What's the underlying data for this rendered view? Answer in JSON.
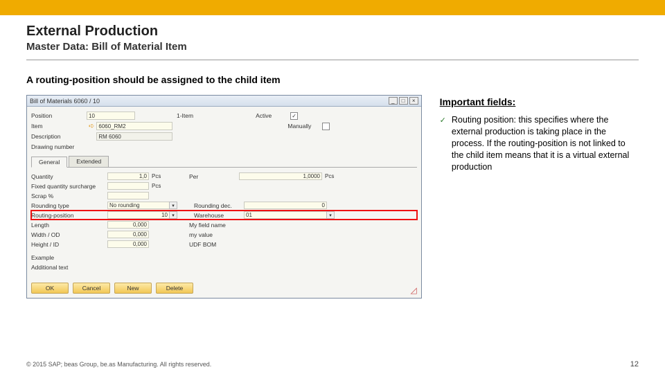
{
  "header": {
    "title": "External Production",
    "subtitle": "Master Data: Bill of Material Item"
  },
  "instruction": "A routing-position should be assigned to the child item",
  "window": {
    "title": "Bill of Materials 6060 / 10",
    "controls": {
      "min": "_",
      "max": "□",
      "close": "×"
    },
    "top_fields": {
      "position_label": "Position",
      "position_value": "10",
      "item_label": "Item",
      "item_value": "6060_RM2",
      "item_id_label": "1-Item",
      "description_label": "Description",
      "description_value": "RM 6060",
      "drawing_label": "Drawing number",
      "active_label": "Active",
      "active_checked": "✓",
      "manually_label": "Manually"
    },
    "tabs": {
      "general": "General",
      "extended": "Extended"
    },
    "rows": {
      "quantity_label": "Quantity",
      "quantity_value": "1,0",
      "quantity_unit": "Pcs",
      "per_label": "Per",
      "per_value": "1,0000",
      "per_unit": "Pcs",
      "fixed_label": "Fixed quantity surcharge",
      "fixed_unit": "Pcs",
      "scrap_label": "Scrap %",
      "rounding_type_label": "Rounding type",
      "rounding_type_value": "No rounding",
      "rounding_dec_label": "Rounding dec.",
      "rounding_dec_value": "0",
      "routing_pos_label": "Routing-position",
      "routing_pos_value": "10",
      "warehouse_label": "Warehouse",
      "warehouse_value": "01",
      "length_label": "Length",
      "length_value": "0,000",
      "myfield_label": "My field name",
      "width_label": "Width / OD",
      "width_value": "0,000",
      "myvalue_label": "my value",
      "height_label": "Height / ID",
      "height_value": "0,000",
      "udfbom_label": "UDF BOM",
      "example_label": "Example",
      "additional_label": "Additional text"
    },
    "buttons": {
      "ok": "OK",
      "cancel": "Cancel",
      "new": "New",
      "delete": "Delete"
    }
  },
  "right": {
    "heading": "Important fields:",
    "bullet": "Routing position: this specifies where the external production is taking place in the process. If the routing-position is not linked to the child item means that it is a virtual external production"
  },
  "footer": {
    "copyright": "© 2015 SAP; beas Group, be.as Manufacturing.  All rights reserved.",
    "page": "12"
  }
}
